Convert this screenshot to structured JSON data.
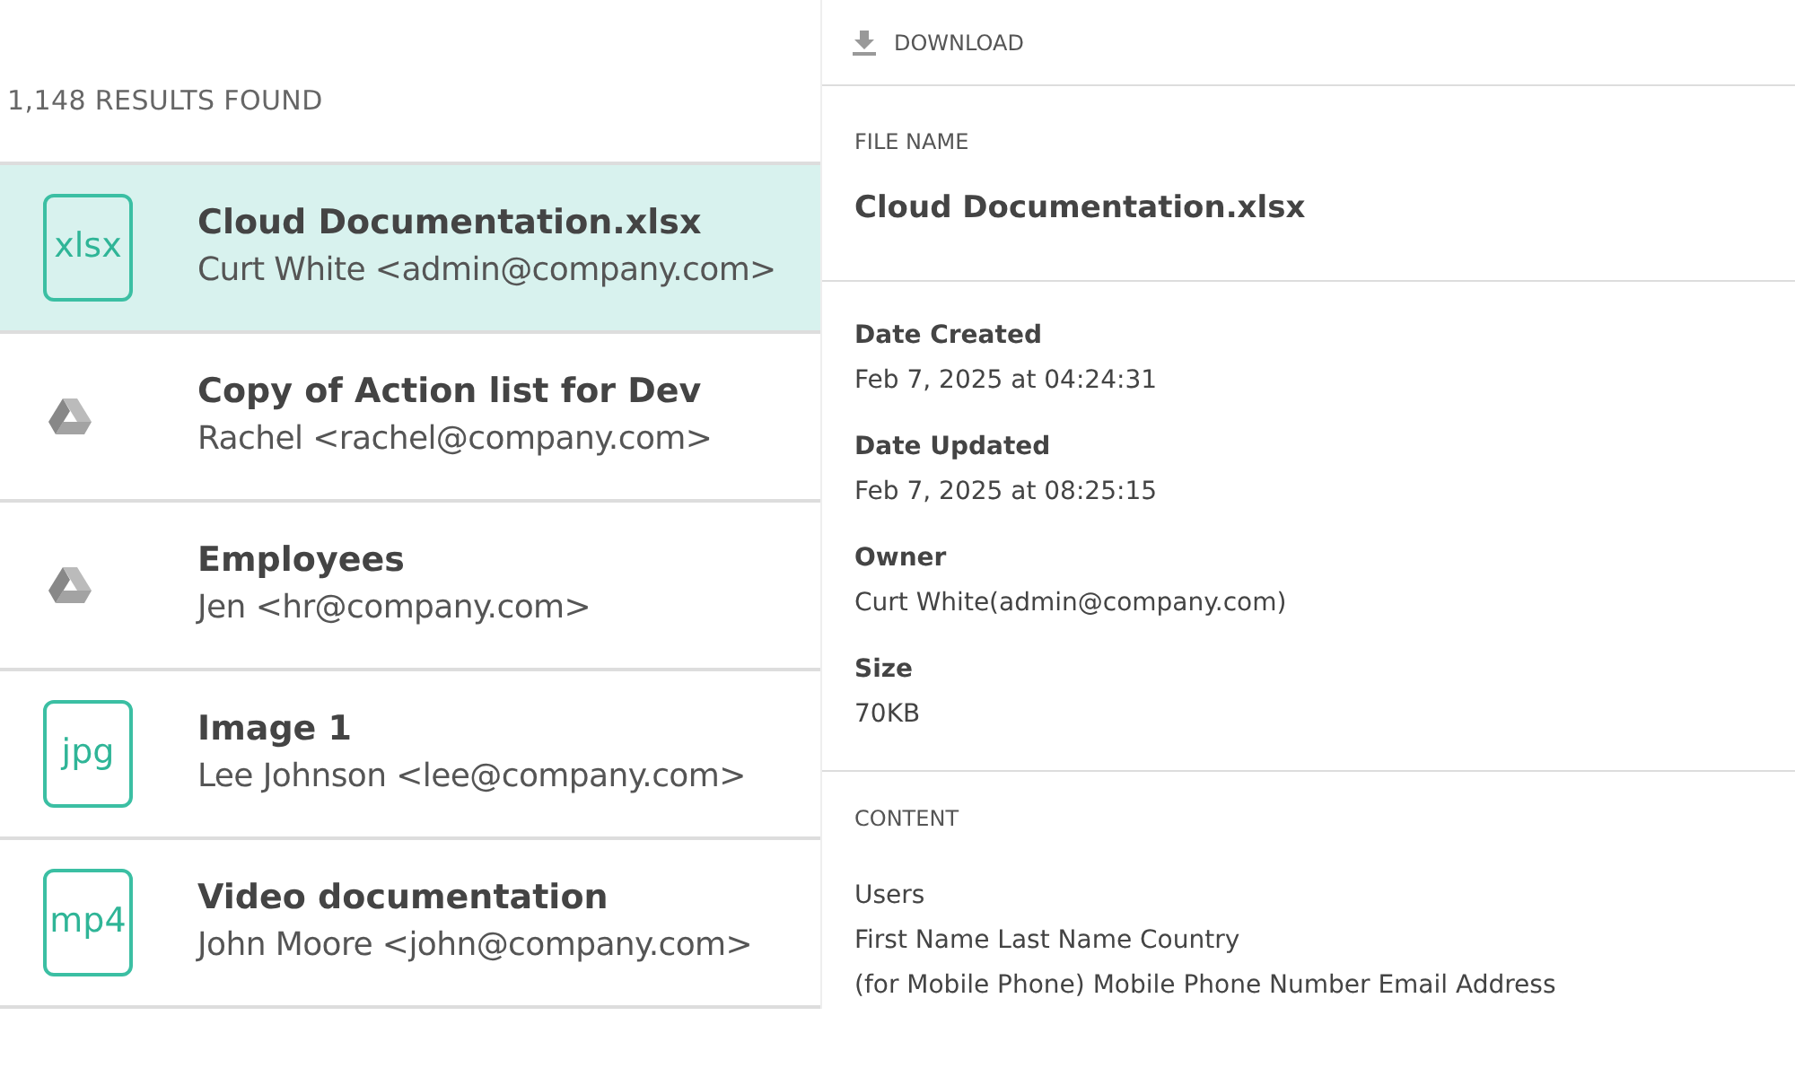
{
  "results_count": "1,148 RESULTS FOUND",
  "results": [
    {
      "kind": "badge",
      "ext": "xlsx",
      "title": "Cloud Documentation.xlsx",
      "owner": "Curt White <admin@company.com>",
      "selected": true
    },
    {
      "kind": "drive",
      "title": "Copy of Action list for Dev",
      "owner": "Rachel <rachel@company.com>",
      "selected": false
    },
    {
      "kind": "drive",
      "title": "Employees",
      "owner": "Jen <hr@company.com>",
      "selected": false
    },
    {
      "kind": "badge",
      "ext": "jpg",
      "title": "Image 1",
      "owner": "Lee Johnson <lee@company.com>",
      "selected": false
    },
    {
      "kind": "badge",
      "ext": "mp4",
      "title": "Video documentation",
      "owner": "John Moore <john@company.com>",
      "selected": false
    }
  ],
  "details": {
    "download": "DOWNLOAD",
    "file_name_label": "FILE NAME",
    "file_name": "Cloud Documentation.xlsx",
    "fields": [
      {
        "label": "Date Created",
        "value": "Feb 7, 2025 at 04:24:31"
      },
      {
        "label": "Date Updated",
        "value": "Feb 7, 2025 at 08:25:15"
      },
      {
        "label": "Owner",
        "value": "Curt White(admin@company.com)"
      },
      {
        "label": "Size",
        "value": "70KB"
      }
    ],
    "content_label": "CONTENT",
    "content_lines": [
      "Users",
      "First Name Last Name Country",
      "(for Mobile Phone) Mobile Phone Number Email Address"
    ]
  }
}
